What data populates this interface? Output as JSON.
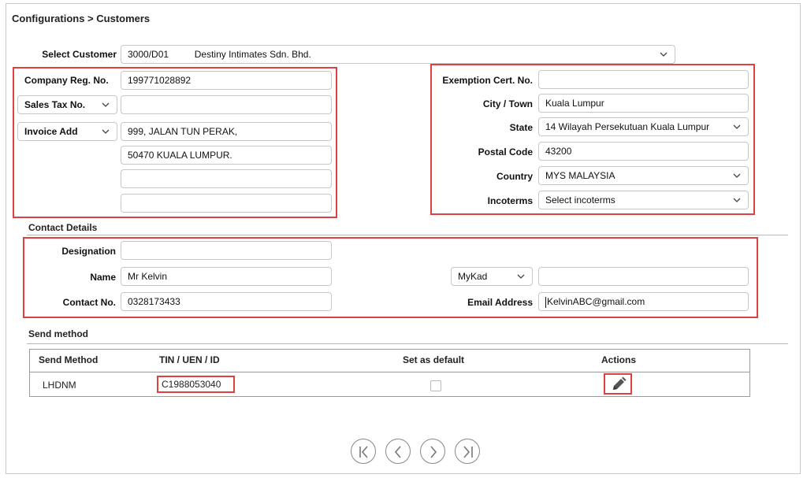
{
  "breadcrumb": "Configurations > Customers",
  "select_customer": {
    "label": "Select Customer",
    "code": "3000/D01",
    "name": "Destiny Intimates Sdn. Bhd."
  },
  "left_panel": {
    "company_reg_label": "Company Reg. No.",
    "company_reg_value": "199771028892",
    "sales_tax_select": "Sales Tax No.",
    "sales_tax_value": "",
    "invoice_add_select": "Invoice Add",
    "address_lines": [
      "999, JALAN TUN PERAK,",
      "50470 KUALA LUMPUR.",
      "",
      ""
    ]
  },
  "right_panel": {
    "exemption_label": "Exemption Cert. No.",
    "exemption_value": "",
    "city_label": "City / Town",
    "city_value": "Kuala Lumpur",
    "state_label": "State",
    "state_value": "14 Wilayah Persekutuan Kuala Lumpur",
    "postal_label": "Postal Code",
    "postal_value": "43200",
    "country_label": "Country",
    "country_value": "MYS MALAYSIA",
    "incoterms_label": "Incoterms",
    "incoterms_value": "Select incoterms"
  },
  "contact": {
    "section_title": "Contact Details",
    "designation_label": "Designation",
    "designation_value": "",
    "name_label": "Name",
    "name_value": "Mr Kelvin",
    "contact_label": "Contact No.",
    "contact_value": "0328173433",
    "id_type": "MyKad",
    "id_value": "",
    "email_label": "Email Address",
    "email_value": "KelvinABC@gmail.com"
  },
  "send_method": {
    "section_title": "Send method",
    "columns": [
      "Send Method",
      "TIN / UEN / ID",
      "Set as default",
      "Actions"
    ],
    "rows": [
      {
        "method": "LHDNM",
        "tin": "C1988053040",
        "is_default": false
      }
    ]
  },
  "pager": {
    "buttons": [
      "first-page-icon",
      "prev-page-icon",
      "next-page-icon",
      "last-page-icon"
    ]
  },
  "colors": {
    "highlight": "#e0403f",
    "border": "#c7c7c7"
  }
}
